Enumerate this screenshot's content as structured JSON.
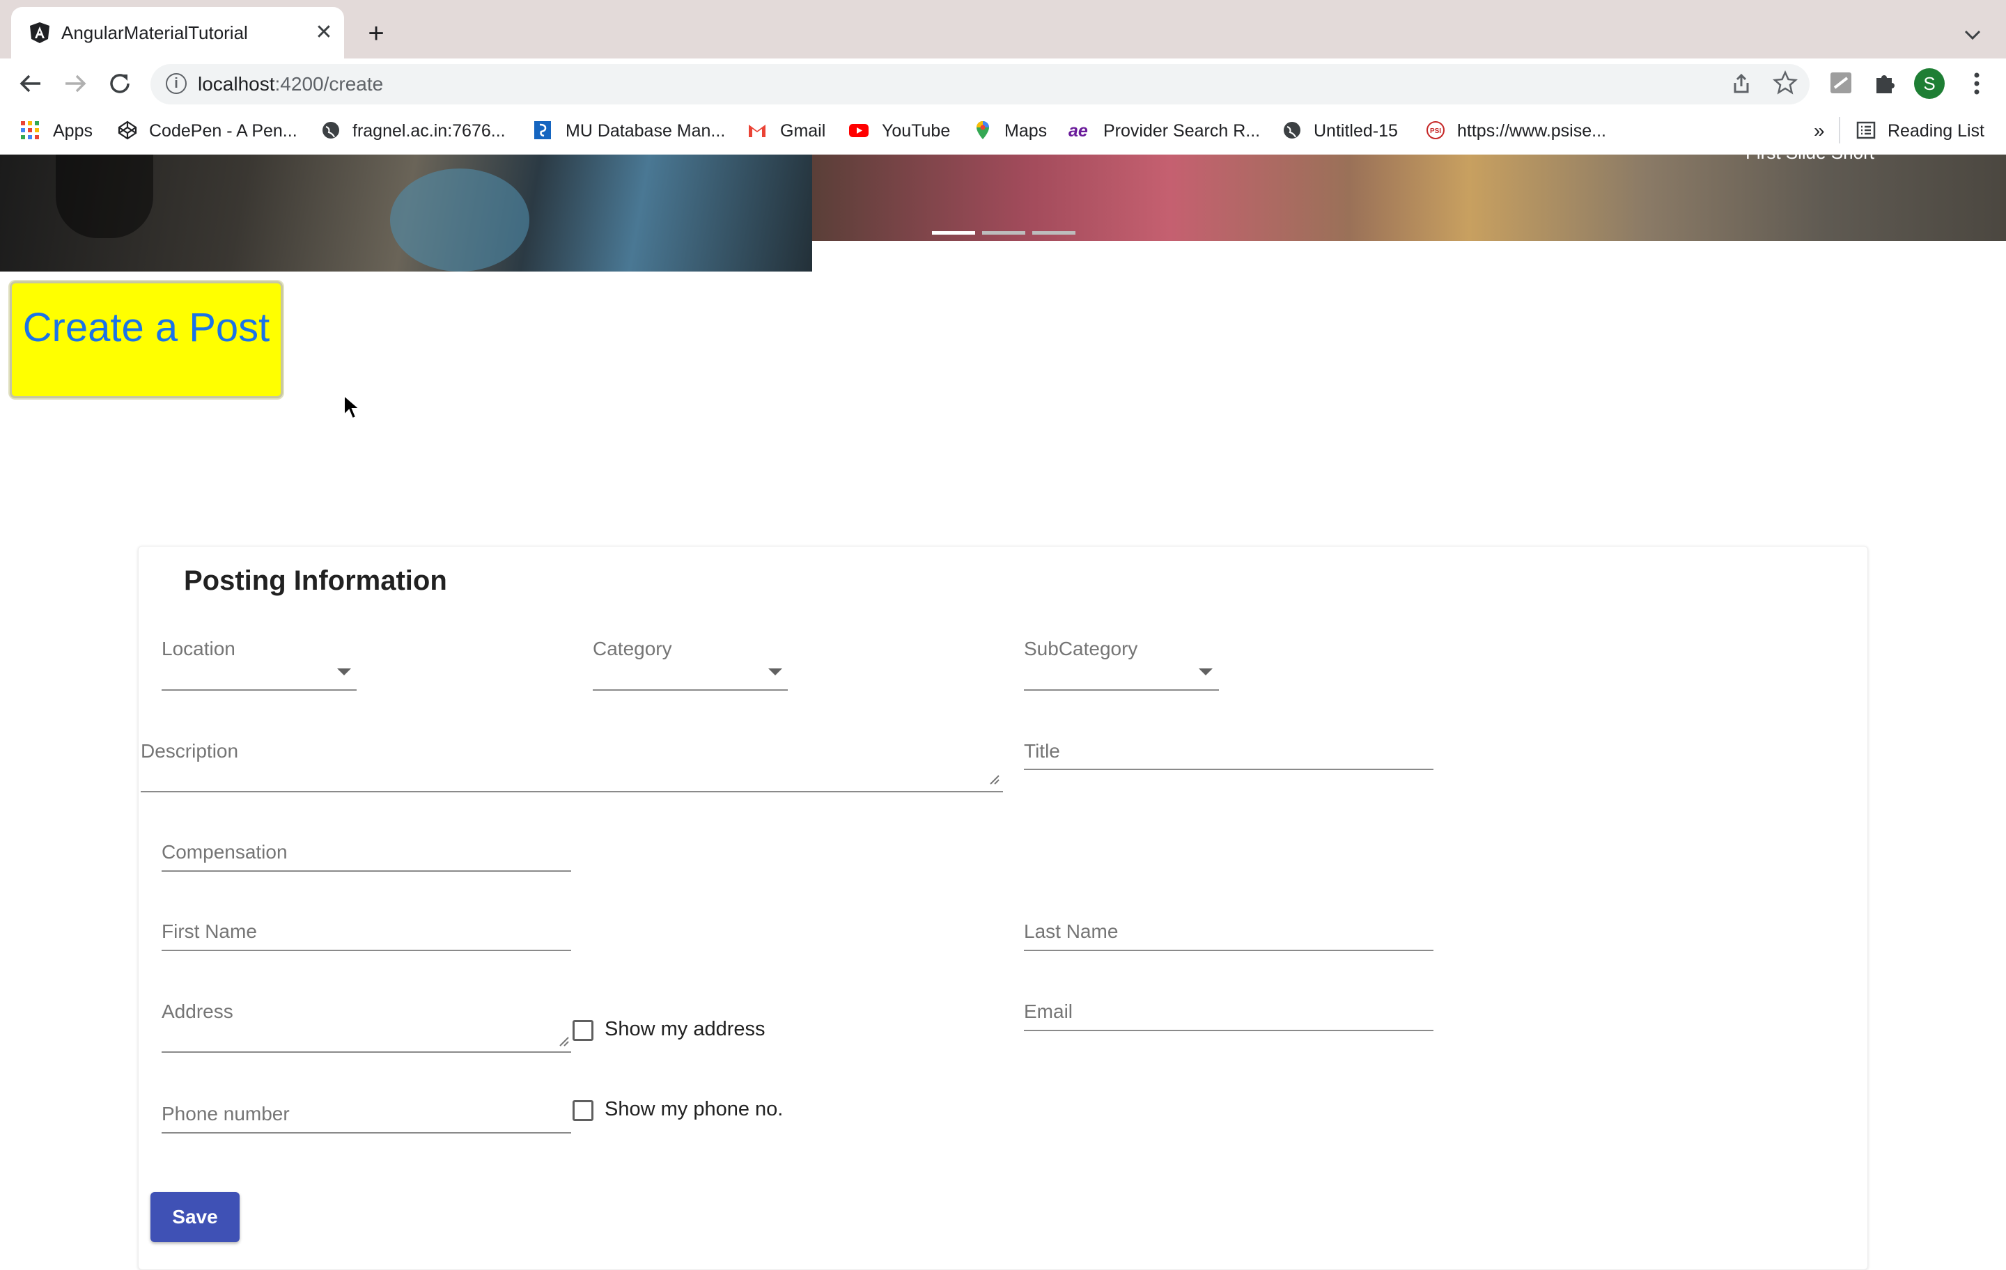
{
  "browser": {
    "tab_title": "AngularMaterialTutorial",
    "tab_close": "✕",
    "new_tab": "+",
    "url_host": "localhost",
    "url_path": ":4200/create",
    "bookmarks": [
      {
        "label": "Apps",
        "icon": "apps-grid-icon"
      },
      {
        "label": "CodePen - A Pen...",
        "icon": "codepen-icon"
      },
      {
        "label": "fragnel.ac.in:7676...",
        "icon": "globe-icon"
      },
      {
        "label": "MU Database Man...",
        "icon": "mu-database-icon"
      },
      {
        "label": "Gmail",
        "icon": "gmail-icon"
      },
      {
        "label": "YouTube",
        "icon": "youtube-icon"
      },
      {
        "label": "Maps",
        "icon": "maps-icon"
      },
      {
        "label": "Provider Search R...",
        "icon": "ae-icon"
      },
      {
        "label": "Untitled-15",
        "icon": "globe-icon"
      },
      {
        "label": "https://www.psise...",
        "icon": "psi-icon"
      }
    ],
    "overflow": "»",
    "reading_list": "Reading List",
    "profile_initial": "S"
  },
  "hero": {
    "caption": "First Slide Short"
  },
  "create_button": {
    "label": "Create a Post"
  },
  "form": {
    "title": "Posting Information",
    "location_label": "Location",
    "category_label": "Category",
    "subcategory_label": "SubCategory",
    "description_label": "Description",
    "title_label": "Title",
    "compensation_label": "Compensation",
    "first_name_label": "First Name",
    "last_name_label": "Last Name",
    "address_label": "Address",
    "show_address_label": "Show my address",
    "email_label": "Email",
    "phone_label": "Phone number",
    "show_phone_label": "Show my phone no.",
    "save_label": "Save"
  },
  "colors": {
    "create_button_bg": "#ffff00",
    "create_button_text": "#1a73e8",
    "save_button_bg": "#3f51b5",
    "profile_bg": "#1e7e34"
  }
}
